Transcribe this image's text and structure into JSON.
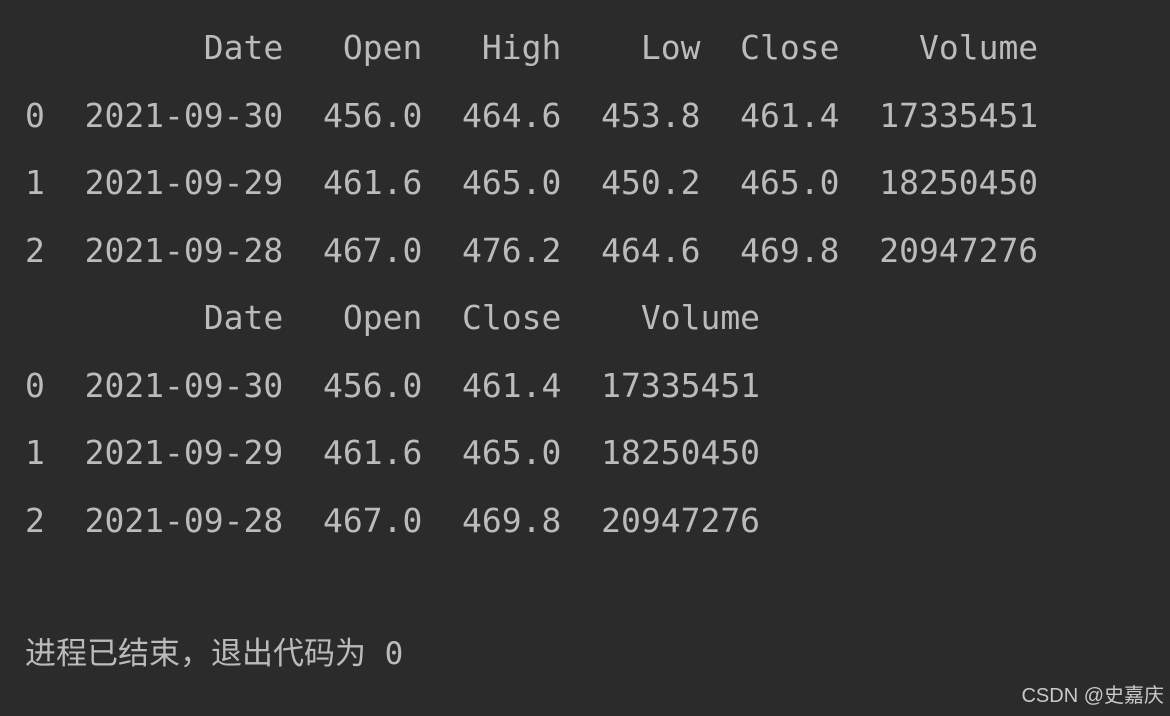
{
  "colors": {
    "background": "#2b2b2b",
    "text": "#bbbbbb"
  },
  "table1": {
    "headers": [
      "",
      "Date",
      "Open",
      "High",
      "Low",
      "Close",
      "Volume"
    ],
    "rows": [
      [
        "0",
        "2021-09-30",
        "456.0",
        "464.6",
        "453.8",
        "461.4",
        "17335451"
      ],
      [
        "1",
        "2021-09-29",
        "461.6",
        "465.0",
        "450.2",
        "465.0",
        "18250450"
      ],
      [
        "2",
        "2021-09-28",
        "467.0",
        "476.2",
        "464.6",
        "469.8",
        "20947276"
      ]
    ]
  },
  "table2": {
    "headers": [
      "",
      "Date",
      "Open",
      "Close",
      "Volume"
    ],
    "rows": [
      [
        "0",
        "2021-09-30",
        "456.0",
        "461.4",
        "17335451"
      ],
      [
        "1",
        "2021-09-29",
        "461.6",
        "465.0",
        "18250450"
      ],
      [
        "2",
        "2021-09-28",
        "467.0",
        "469.8",
        "20947276"
      ]
    ]
  },
  "exit_message": "进程已结束，退出代码为 0",
  "watermark": "CSDN @史嘉庆"
}
